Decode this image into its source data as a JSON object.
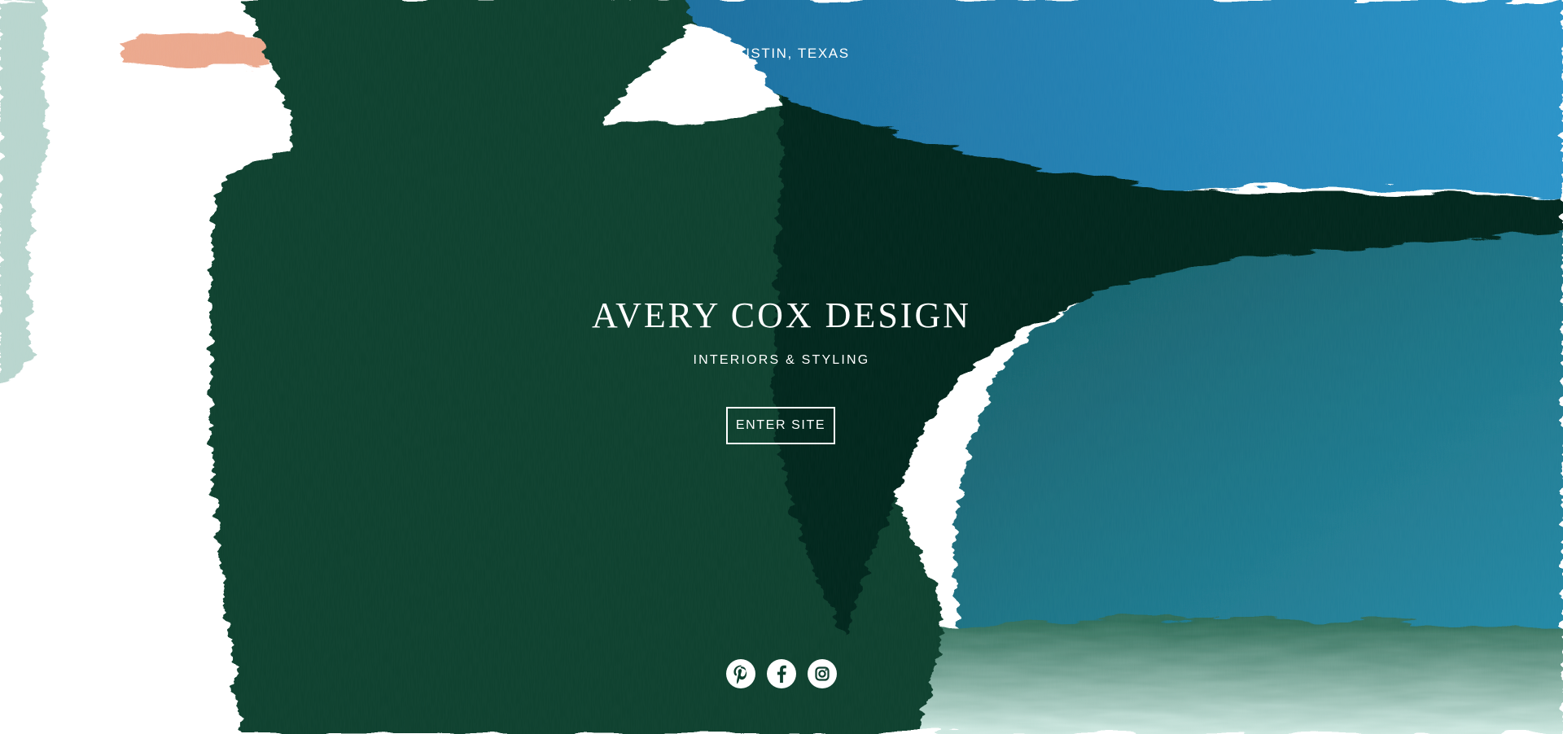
{
  "location_text": "N AUSTIN, TEXAS",
  "brand": {
    "name": "AVERY COX DESIGN",
    "tagline": "INTERIORS & STYLING"
  },
  "cta": {
    "label": "ENTER SITE"
  },
  "social": [
    {
      "icon": "pinterest-icon"
    },
    {
      "icon": "facebook-icon"
    },
    {
      "icon": "instagram-icon"
    }
  ],
  "colors": {
    "dark_green": "#0f3f2f",
    "deep_green": "#0a2b22",
    "blue": "#1f86bd",
    "teal": "#1f6f84",
    "peach": "#e7a184",
    "text": "#ffffff"
  }
}
